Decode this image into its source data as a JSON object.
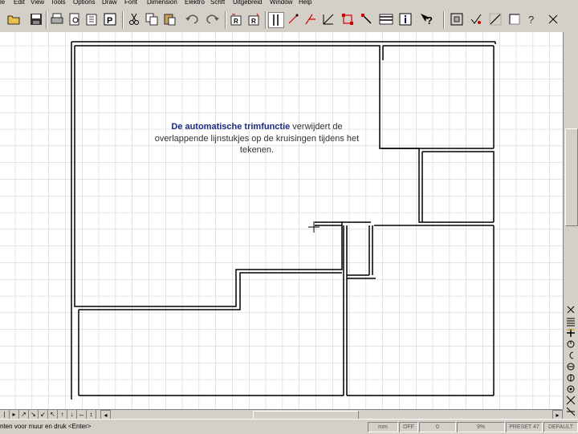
{
  "menu": {
    "items": [
      "le",
      "Edit",
      "View",
      "Tools",
      "Options",
      "Draw",
      "Font",
      "Dimension",
      "Elektro",
      "Schft",
      "Uitgebreid",
      "Window",
      "Help"
    ]
  },
  "toolbar": {
    "icons": [
      "open-folder-icon",
      "save-icon",
      "print-icon",
      "print-preview-icon",
      "paste-special-icon",
      "cut-icon",
      "copy-icon",
      "paste-icon",
      "undo-icon",
      "redo-icon",
      "redraw-icon",
      "refresh-icon",
      "wall-icon",
      "line-tool-icon",
      "trim-icon",
      "node-icon",
      "select-box-icon",
      "delete-segment-icon",
      "layer-icon",
      "info-icon",
      "help-context-icon",
      "zoom-window-icon",
      "snap-icon",
      "square-icon",
      "help-icon",
      "close-icon"
    ]
  },
  "canvas": {
    "note_highlight": "De automatische trimfunctie",
    "note_rest": " verwijdert de overlappende lijnstukjes op de kruisingen tijdens het tekenen."
  },
  "right_rail": {
    "buttons": [
      "rail-close-icon",
      "rail-list-icon",
      "rail-plus-icon",
      "rail-rotate-icon",
      "rail-back-icon",
      "rail-copy-icon",
      "rail-mirror-icon",
      "rail-layer-icon",
      "rail-snap-icon",
      "rail-grid-icon",
      "rail-x-icon"
    ]
  },
  "statusbar": {
    "prompt": "nten voor muur en druk <Enter>",
    "unit": "mm",
    "snap": "OFF",
    "angle": "0",
    "zoom": "9%",
    "preset": "PRESET 47",
    "layer": "DEFAULT"
  }
}
